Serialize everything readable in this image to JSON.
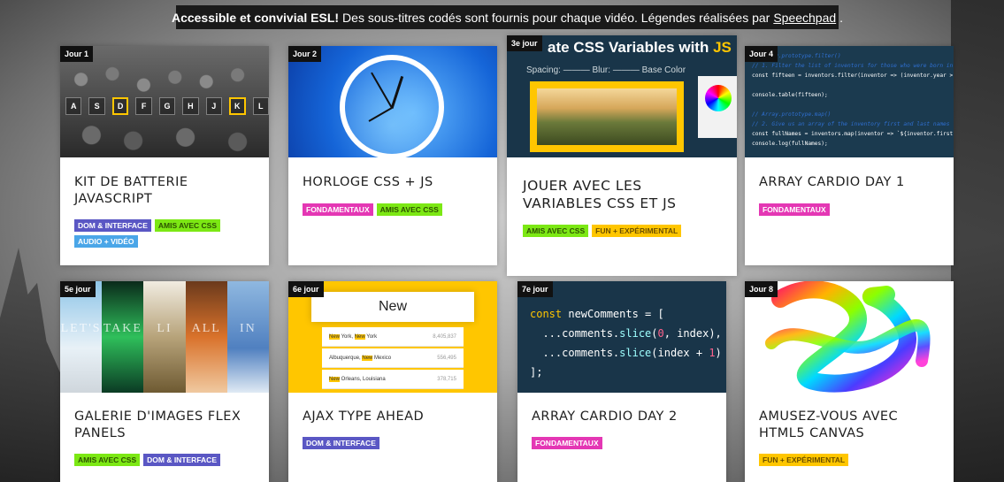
{
  "banner": {
    "lead": "Accessible et convivial ESL!",
    "text": "Des sous-titres codés sont fournis pour chaque vidéo. Légendes réalisées par",
    "link": "Speechpad",
    "tail": "."
  },
  "tag_colors": {
    "DOM & INTERFACE": "#5a57c4",
    "AMIS AVEC CSS": "#7ce814",
    "AUDIO + VIDÉO": "#4aa6e8",
    "FONDAMENTAUX": "#e437b4",
    "FUN + EXPÉRIMENTAL": "#ffc600"
  },
  "cards": [
    {
      "day": "Jour 1",
      "title": "Kit de batterie JavaScript",
      "tags": [
        "DOM & INTERFACE",
        "AMIS AVEC CSS",
        "AUDIO + VIDÉO"
      ],
      "keys": [
        "A",
        "S",
        "D",
        "F",
        "G",
        "H",
        "J",
        "K",
        "L"
      ],
      "active_keys": [
        "D",
        "K"
      ]
    },
    {
      "day": "Jour 2",
      "title": "Horloge CSS + JS",
      "tags": [
        "FONDAMENTAUX",
        "AMIS AVEC CSS"
      ]
    },
    {
      "day": "3e jour",
      "title": "Jouer avec les variables CSS et JS",
      "tags": [
        "AMIS AVEC CSS",
        "FUN + EXPÉRIMENTAL"
      ],
      "thumb_title": "ate CSS Variables with",
      "thumb_title_js": "JS",
      "thumb_controls": "Spacing: ——— Blur: ——— Base Color"
    },
    {
      "day": "Jour 4",
      "title": "Array Cardio Day 1",
      "tags": [
        "FONDAMENTAUX"
      ],
      "code": [
        {
          "k": "c-com",
          "t": "// Array.prototype.filter()"
        },
        {
          "k": "c-com",
          "t": "// 1. Filter the list of inventors for those who were born in"
        },
        {
          "k": "c-tx",
          "t": "const fifteen = inventors.filter(inventor => (inventor.year >"
        },
        {
          "k": "c-tx",
          "t": ""
        },
        {
          "k": "c-tx",
          "t": "console.table(fifteen);"
        },
        {
          "k": "c-tx",
          "t": ""
        },
        {
          "k": "c-com",
          "t": "// Array.prototype.map()"
        },
        {
          "k": "c-com",
          "t": "// 2. Give us an array of the inventory first and last names"
        },
        {
          "k": "c-tx",
          "t": "const fullNames = inventors.map(inventor => `${inventor.first"
        },
        {
          "k": "c-tx",
          "t": "console.log(fullNames);"
        }
      ]
    },
    {
      "day": "5e jour",
      "title": "Galerie d'images Flex Panels",
      "tags": [
        "AMIS AVEC CSS",
        "DOM & INTERFACE"
      ],
      "panels": [
        "LET'S",
        "TAKE",
        "LI",
        "ALL",
        "IN"
      ]
    },
    {
      "day": "6e jour",
      "title": "Ajax Type Ahead",
      "tags": [
        "DOM & INTERFACE"
      ],
      "search": "New",
      "rows": [
        {
          "hl1": "New",
          "mid": " York, ",
          "hl2": "New",
          "end": " York",
          "num": "8,405,837"
        },
        {
          "hl1": "",
          "mid": "Albuquerque, ",
          "hl2": "New",
          "end": " Mexico",
          "num": "556,495"
        },
        {
          "hl1": "New",
          "mid": " Orleans, Louisiana",
          "hl2": "",
          "end": "",
          "num": "378,715"
        }
      ]
    },
    {
      "day": "7e jour",
      "title": "Array Cardio Day 2",
      "tags": [
        "FONDAMENTAUX"
      ]
    },
    {
      "day": "Jour 8",
      "title": "Amusez-vous avec HTML5 Canvas",
      "tags": [
        "FUN + EXPÉRIMENTAL"
      ]
    }
  ]
}
